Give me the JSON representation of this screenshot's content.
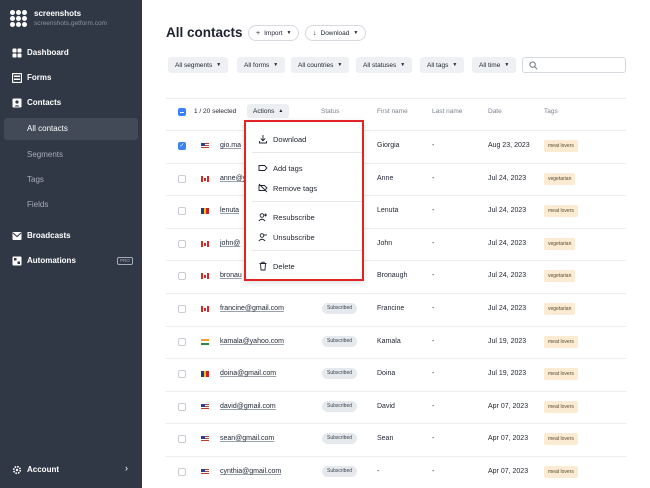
{
  "brand": {
    "name": "screenshots",
    "subtitle": "screenshots.getform.com"
  },
  "sidebar": {
    "items": [
      {
        "label": "Dashboard",
        "icon": "dashboard-icon"
      },
      {
        "label": "Forms",
        "icon": "forms-icon"
      },
      {
        "label": "Contacts",
        "icon": "contacts-icon"
      },
      {
        "label": "All contacts"
      },
      {
        "label": "Segments"
      },
      {
        "label": "Tags"
      },
      {
        "label": "Fields"
      },
      {
        "label": "Broadcasts",
        "icon": "broadcasts-icon"
      },
      {
        "label": "Automations",
        "icon": "automations-icon",
        "badge": "PRO"
      }
    ],
    "account_label": "Account"
  },
  "header": {
    "title": "All contacts",
    "import_label": "Import",
    "download_label": "Download"
  },
  "filters": [
    "All segments",
    "All forms",
    "All countries",
    "All statuses",
    "All tags",
    "All time"
  ],
  "search": {
    "placeholder": ""
  },
  "table": {
    "selected_text": "1 / 20 selected",
    "actions_label": "Actions",
    "columns": {
      "status": "Status",
      "first_name": "First name",
      "last_name": "Last name",
      "date": "Date",
      "tags": "Tags"
    },
    "rows": [
      {
        "email": "gio.ma",
        "status": "",
        "first": "Giorgia",
        "last": "-",
        "date": "Aug 23, 2023",
        "tag": "meat lovers",
        "checked": true,
        "flag": "us"
      },
      {
        "email": "anne@y",
        "status": "",
        "first": "Anne",
        "last": "-",
        "date": "Jul 24, 2023",
        "tag": "vegetarian",
        "checked": false,
        "flag": "ca"
      },
      {
        "email": "lenuta",
        "status": "",
        "first": "Lenuta",
        "last": "-",
        "date": "Jul 24, 2023",
        "tag": "meat lovers",
        "checked": false,
        "flag": "ro"
      },
      {
        "email": "john@",
        "status": "",
        "first": "John",
        "last": "-",
        "date": "Jul 24, 2023",
        "tag": "vegetarian",
        "checked": false,
        "flag": "ca"
      },
      {
        "email": "bronau",
        "status": "",
        "first": "Bronaugh",
        "last": "-",
        "date": "Jul 24, 2023",
        "tag": "vegetarian",
        "checked": false,
        "flag": "ca"
      },
      {
        "email": "francine@gmail.com",
        "status": "Subscribed",
        "first": "Francine",
        "last": "-",
        "date": "Jul 24, 2023",
        "tag": "vegetarian",
        "checked": false,
        "flag": "ca"
      },
      {
        "email": "kamala@yahoo.com",
        "status": "Subscribed",
        "first": "Kamala",
        "last": "-",
        "date": "Jul 19, 2023",
        "tag": "meat lovers",
        "checked": false,
        "flag": "in"
      },
      {
        "email": "doina@gmail.com",
        "status": "Subscribed",
        "first": "Doina",
        "last": "-",
        "date": "Jul 19, 2023",
        "tag": "meat lovers",
        "checked": false,
        "flag": "ro"
      },
      {
        "email": "david@gmail.com",
        "status": "Subscribed",
        "first": "David",
        "last": "-",
        "date": "Apr 07, 2023",
        "tag": "meat lovers",
        "checked": false,
        "flag": "us"
      },
      {
        "email": "sean@gmail.com",
        "status": "Subscribed",
        "first": "Sean",
        "last": "-",
        "date": "Apr 07, 2023",
        "tag": "meat lovers",
        "checked": false,
        "flag": "us"
      },
      {
        "email": "cynthia@gmail.com",
        "status": "Subscribed",
        "first": "-",
        "last": "-",
        "date": "Apr 07, 2023",
        "tag": "meat lovers",
        "checked": false,
        "flag": "us"
      }
    ]
  },
  "actions_menu": {
    "items": [
      {
        "label": "Download",
        "icon": "download-icon"
      },
      {
        "label": "Add tags",
        "icon": "tag-icon"
      },
      {
        "label": "Remove tags",
        "icon": "tag-off-icon"
      },
      {
        "label": "Resubscribe",
        "icon": "user-plus-icon"
      },
      {
        "label": "Unsubscribe",
        "icon": "user-minus-icon"
      },
      {
        "label": "Delete",
        "icon": "trash-icon"
      }
    ]
  },
  "colors": {
    "sidebar_bg": "#313845",
    "accent": "#3b82f6",
    "menu_highlight": "#e02424",
    "tag_bg": "#fbebd2"
  }
}
